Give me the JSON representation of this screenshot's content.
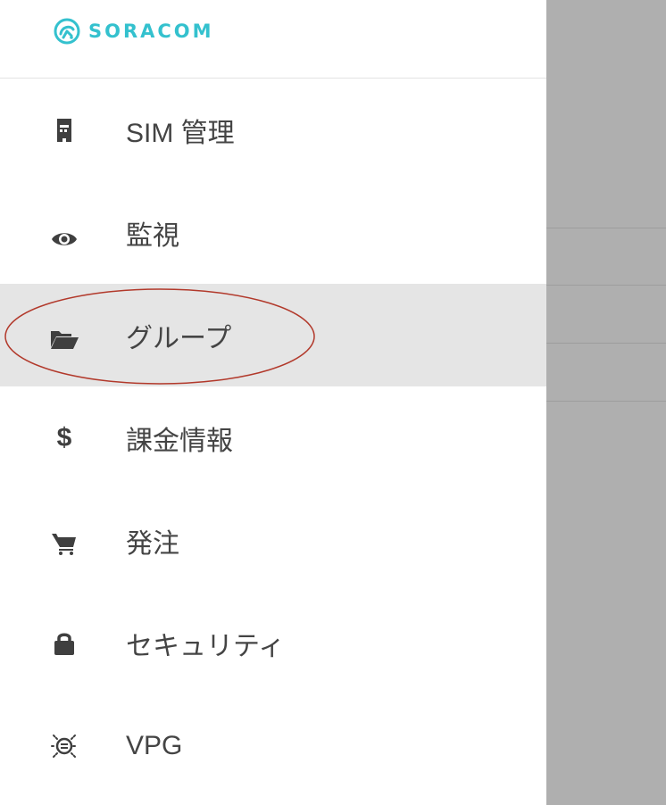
{
  "brand": {
    "name": "SORACOM",
    "color": "#34c1ce"
  },
  "menu": {
    "items": [
      {
        "label": "SIM 管理",
        "icon": "sim-card-icon"
      },
      {
        "label": "監視",
        "icon": "eye-icon"
      },
      {
        "label": "グループ",
        "icon": "folder-open-icon"
      },
      {
        "label": "課金情報",
        "icon": "dollar-icon",
        "glyph": "$"
      },
      {
        "label": "発注",
        "icon": "cart-icon"
      },
      {
        "label": "セキュリティ",
        "icon": "lock-icon"
      },
      {
        "label": "VPG",
        "icon": "vpg-icon"
      }
    ],
    "active_item": "グループ"
  },
  "colors": {
    "active_background": "#e5e5e5",
    "backdrop": "#afafaf",
    "annotation": "#c0392b"
  }
}
